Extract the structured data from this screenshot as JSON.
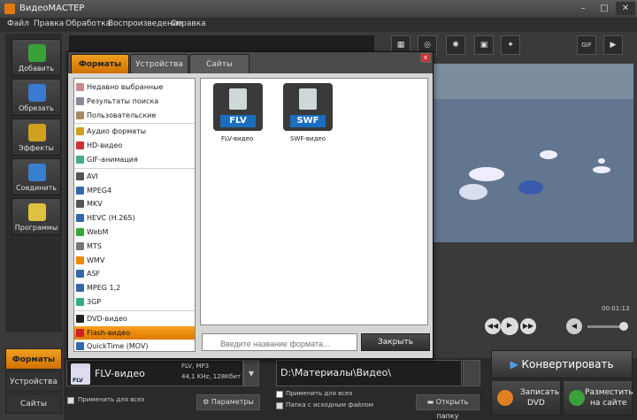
{
  "window": {
    "title": "ВидеоМАСТЕР",
    "controls": [
      "–",
      "□",
      "✕"
    ]
  },
  "menu": [
    "Файл",
    "Правка",
    "Обработка",
    "Воспроизведение",
    "Справка"
  ],
  "left_tools": [
    {
      "label": "Добавить",
      "icon": "add-video-icon",
      "color": "#3aa03a"
    },
    {
      "label": "Обрезать",
      "icon": "cut-icon",
      "color": "#3a7ad0"
    },
    {
      "label": "Эффекты",
      "icon": "effects-icon",
      "color": "#d0a020"
    },
    {
      "label": "Соединить",
      "icon": "join-icon",
      "color": "#3a80d0"
    },
    {
      "label": "Программы",
      "icon": "programs-icon",
      "color": "#e0c040"
    }
  ],
  "bottom_tabs": [
    "Форматы",
    "Устройства",
    "Сайты"
  ],
  "dialog": {
    "tabs": [
      "Форматы",
      "Устройства",
      "Сайты"
    ],
    "close_glyph": "x",
    "categories": [
      {
        "label": "Недавно выбранные",
        "icon": "recent-icon",
        "color": "#c88"
      },
      {
        "label": "Результаты поиска",
        "icon": "search-results-icon",
        "color": "#889"
      },
      {
        "label": "Пользовательские",
        "icon": "user-icon",
        "color": "#a86"
      },
      {
        "label": "Аудио форматы",
        "icon": "audio-icon",
        "color": "#d0a020"
      },
      {
        "label": "HD-видео",
        "icon": "hd-icon",
        "color": "#c33"
      },
      {
        "label": "GIF-анимация",
        "icon": "gif-icon",
        "color": "#4a8"
      },
      {
        "label": "AVI",
        "icon": "avi-icon",
        "color": "#555"
      },
      {
        "label": "MPEG4",
        "icon": "mpeg4-icon",
        "color": "#36a"
      },
      {
        "label": "MKV",
        "icon": "mkv-icon",
        "color": "#555"
      },
      {
        "label": "HEVC (H.265)",
        "icon": "hevc-icon",
        "color": "#36a"
      },
      {
        "label": "WebM",
        "icon": "webm-icon",
        "color": "#3a3"
      },
      {
        "label": "MTS",
        "icon": "mts-icon",
        "color": "#777"
      },
      {
        "label": "WMV",
        "icon": "wmv-icon",
        "color": "#e80"
      },
      {
        "label": "ASF",
        "icon": "asf-icon",
        "color": "#36a"
      },
      {
        "label": "MPEG 1,2",
        "icon": "mpeg12-icon",
        "color": "#36a"
      },
      {
        "label": "3GP",
        "icon": "3gp-icon",
        "color": "#3a8"
      },
      {
        "label": "DVD-видео",
        "icon": "dvd-icon",
        "color": "#222"
      },
      {
        "label": "Flash-видео",
        "icon": "flash-icon",
        "color": "#c22"
      },
      {
        "label": "QuickTime (MOV)",
        "icon": "quicktime-icon",
        "color": "#36a"
      }
    ],
    "formats": [
      {
        "badge": "FLV",
        "name": "FLV-видео"
      },
      {
        "badge": "SWF",
        "name": "SWF-видео"
      }
    ],
    "search_placeholder": "Введите название формата...",
    "close_button": "Закрыть"
  },
  "output": {
    "format_badge": "FLV",
    "format_name": "FLV-видео",
    "specs_line1": "FLV, MP3",
    "specs_line2": "44,1 KHz, 128Кбит",
    "apply_all": "Применить для всех",
    "params_button": "Параметры",
    "path": "D:\\Материалы\\Видео\\",
    "apply_all_right": "Применить для всех",
    "source_folder": "Папка с исходным файлом",
    "open_folder_button": "Открыть папку"
  },
  "actions": {
    "convert": "Конвертировать",
    "burn_dvd_1": "Записать",
    "burn_dvd_2": "DVD",
    "publish_1": "Разместить",
    "publish_2": "на сайте"
  },
  "player": {
    "timecode": "00:01:13",
    "gif_label": "GIF"
  }
}
